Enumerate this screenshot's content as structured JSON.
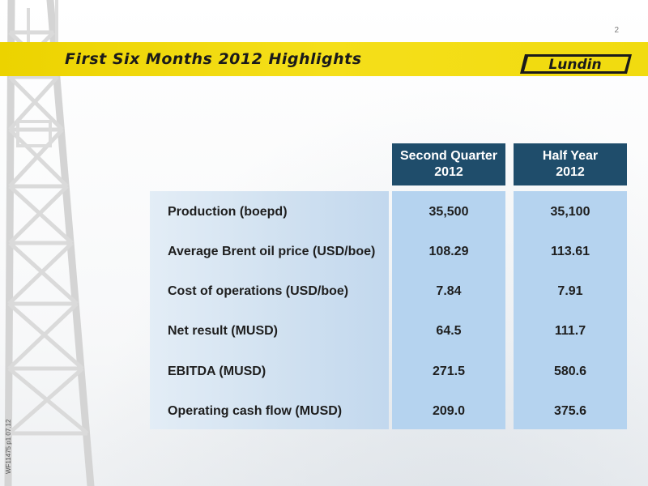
{
  "page_number": "2",
  "title": "First Six Months 2012 Highlights",
  "logo_text": "Lundin",
  "side_code": "WF11475 p1 07.12",
  "colors": {
    "banner": "#f1db10",
    "header": "#1f4d6b",
    "value_panel": "#b5d3ef",
    "label_panel": "#d6e5f3"
  },
  "table": {
    "columns": [
      {
        "line1": "Second Quarter",
        "line2": "2012"
      },
      {
        "line1": "Half Year",
        "line2": "2012"
      }
    ],
    "rows": [
      {
        "label": "Production (boepd)",
        "values": [
          "35,500",
          "35,100"
        ]
      },
      {
        "label": "Average Brent oil price (USD/boe)",
        "values": [
          "108.29",
          "113.61"
        ]
      },
      {
        "label": "Cost of operations (USD/boe)",
        "values": [
          "7.84",
          "7.91"
        ]
      },
      {
        "label": "Net result (MUSD)",
        "values": [
          "64.5",
          "111.7"
        ]
      },
      {
        "label": "EBITDA (MUSD)",
        "values": [
          "271.5",
          "580.6"
        ]
      },
      {
        "label": "Operating cash flow (MUSD)",
        "values": [
          "209.0",
          "375.6"
        ]
      }
    ]
  }
}
